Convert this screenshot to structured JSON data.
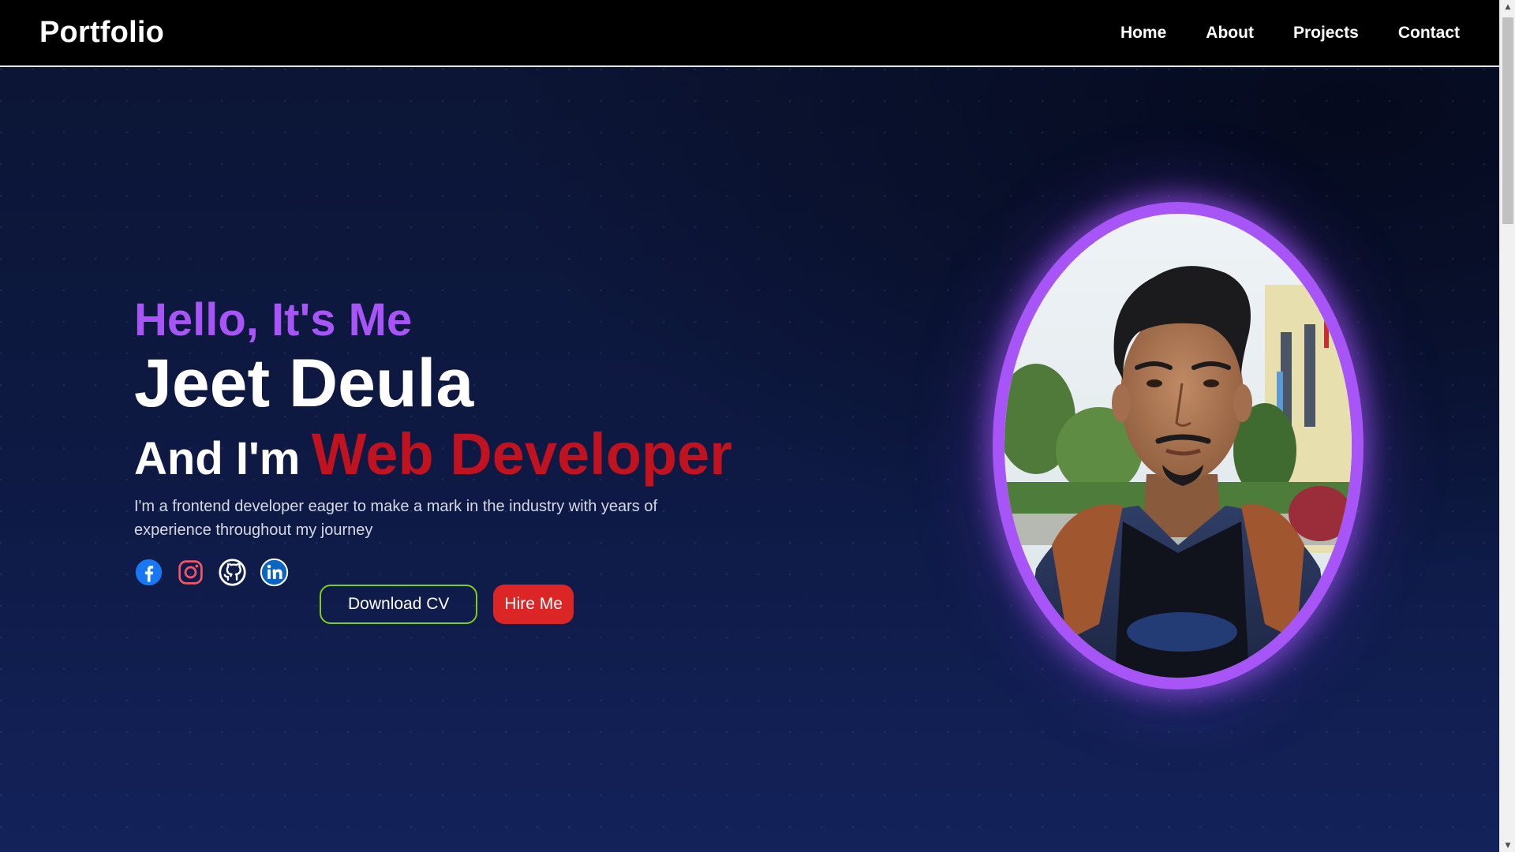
{
  "navbar": {
    "logo": "Portfolio",
    "links": [
      "Home",
      "About",
      "Projects",
      "Contact"
    ]
  },
  "hero": {
    "greeting": "Hello, It's Me",
    "name": "Jeet Deula",
    "role_prefix": "And I'm",
    "role_title": "Web Developer",
    "description": "I'm a frontend developer eager to make a mark in the industry with years of experience throughout my journey",
    "socials": [
      "facebook-icon",
      "instagram-icon",
      "github-icon",
      "linkedin-icon"
    ],
    "buttons": {
      "download_cv": "Download CV",
      "hire_me": "Hire Me"
    }
  },
  "colors": {
    "accent_purple": "#a855f7",
    "accent_red": "#c1121f",
    "hire_button": "#dc2626",
    "cv_border": "#84cc16",
    "background": "#0e1a45"
  }
}
